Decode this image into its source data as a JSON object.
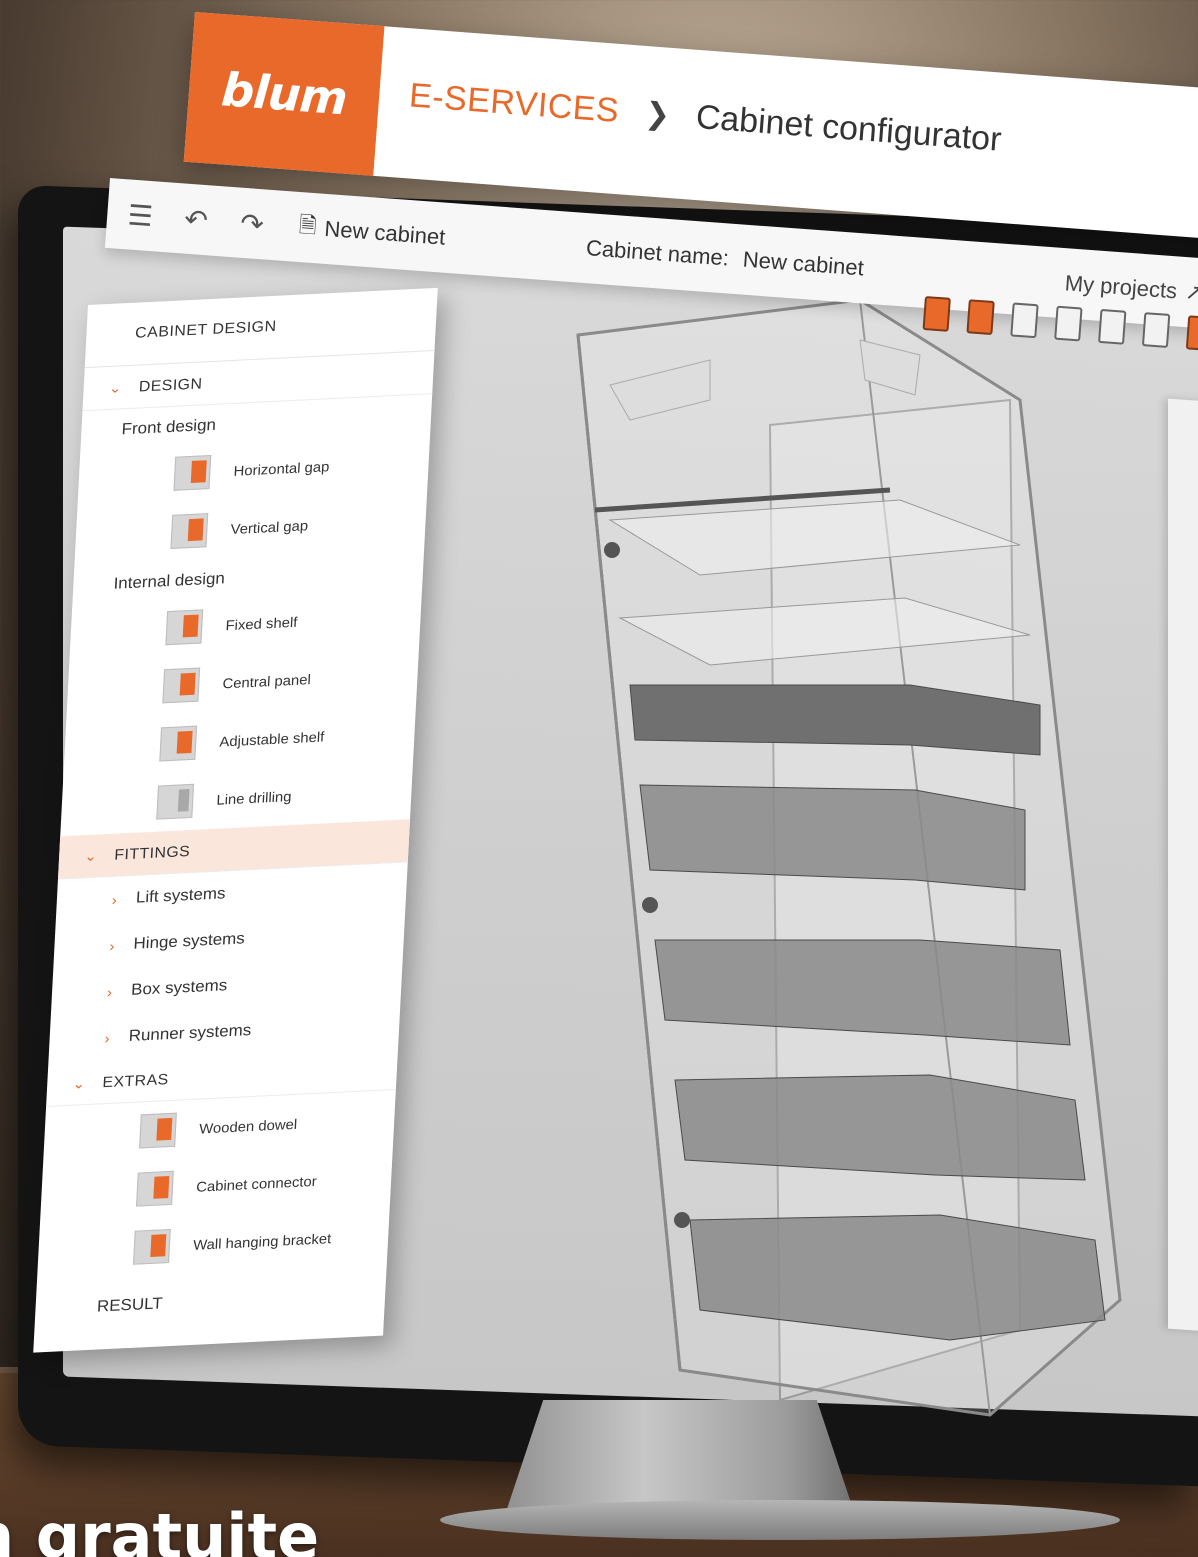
{
  "header": {
    "logo": "blum",
    "breadcrumb_root": "E-SERVICES",
    "page_title": "Cabinet configurator"
  },
  "toolbar": {
    "new_cabinet_label": "New cabinet",
    "cabinet_name_label": "Cabinet name:",
    "cabinet_name_value": "New cabinet",
    "my_projects_label": "My projects"
  },
  "sidebar": {
    "heading": "CABINET DESIGN",
    "design": {
      "label": "DESIGN",
      "groups": [
        {
          "label": "Front design",
          "items": [
            {
              "label": "Horizontal gap"
            },
            {
              "label": "Vertical gap"
            }
          ]
        },
        {
          "label": "Internal design",
          "items": [
            {
              "label": "Fixed shelf"
            },
            {
              "label": "Central panel"
            },
            {
              "label": "Adjustable shelf"
            },
            {
              "label": "Line drilling"
            }
          ]
        }
      ]
    },
    "fittings": {
      "label": "FITTINGS",
      "items": [
        {
          "label": "Lift systems"
        },
        {
          "label": "Hinge systems"
        },
        {
          "label": "Box systems"
        },
        {
          "label": "Runner systems"
        }
      ]
    },
    "extras": {
      "label": "EXTRAS",
      "items": [
        {
          "label": "Wooden dowel"
        },
        {
          "label": "Cabinet connector"
        },
        {
          "label": "Wall hanging bracket"
        }
      ]
    },
    "result_label": "RESULT"
  },
  "caption": "n gratuite",
  "colors": {
    "brand_orange": "#e8692a",
    "active_section_bg": "#fbe6db"
  }
}
